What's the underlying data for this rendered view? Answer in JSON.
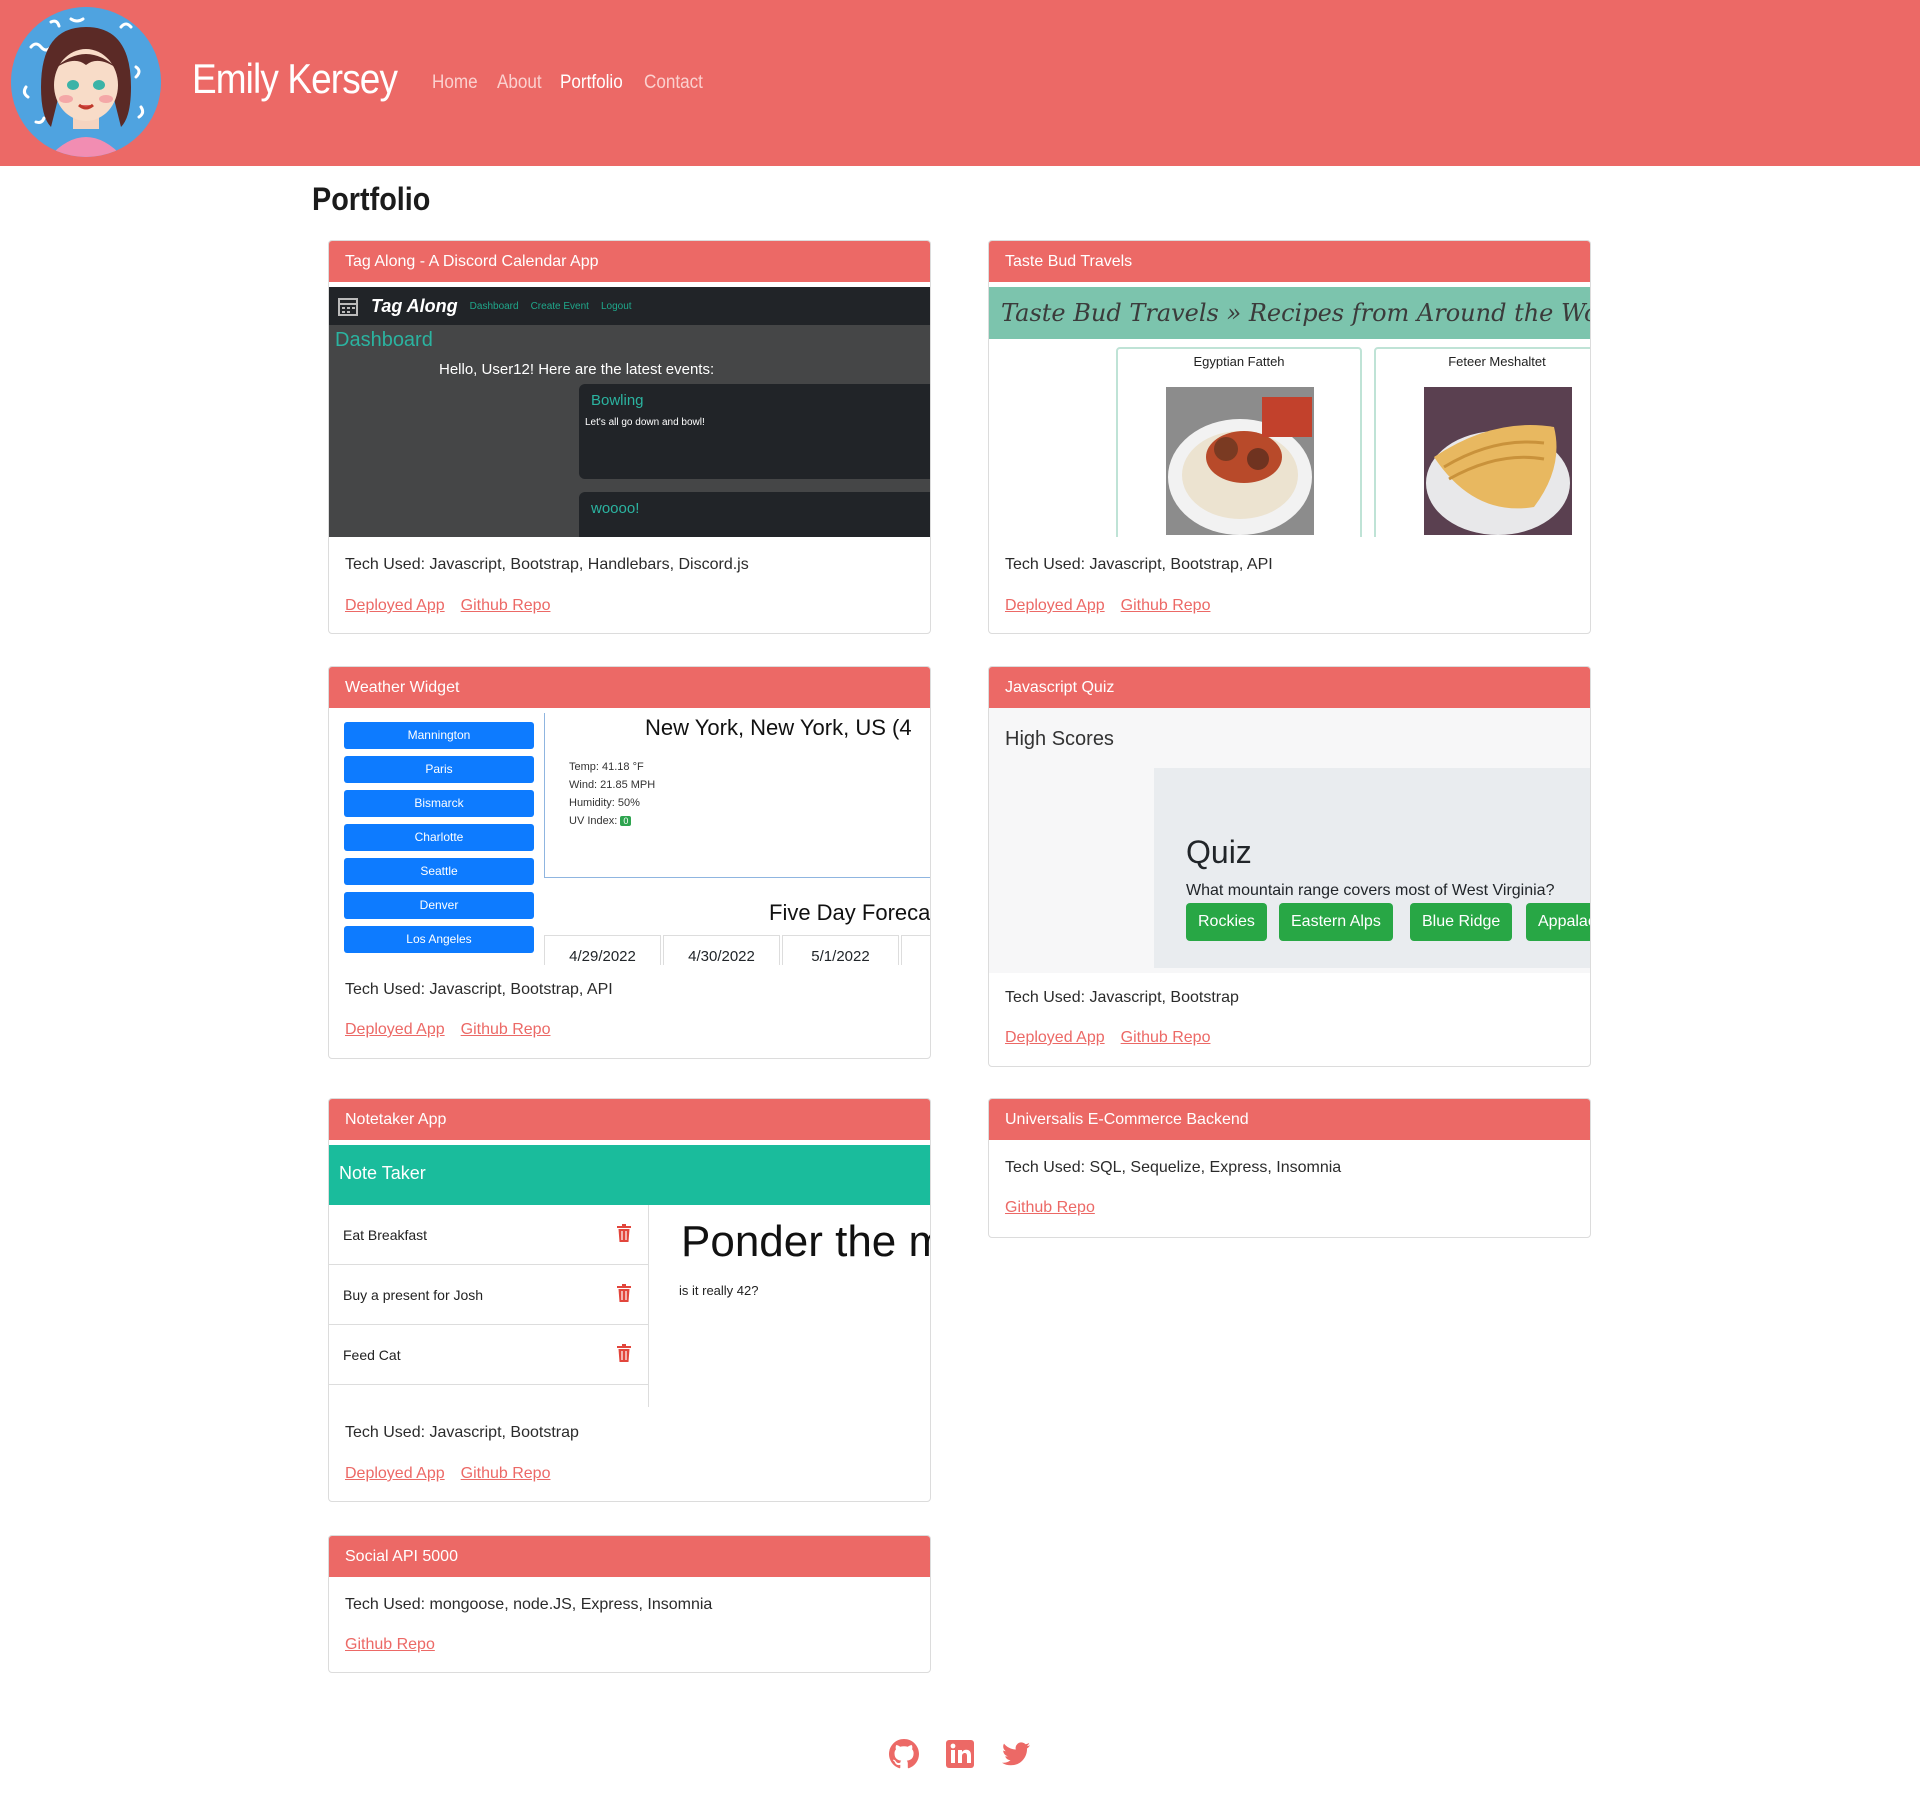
{
  "header": {
    "name": "Emily Kersey",
    "nav": [
      "Home",
      "About",
      "Portfolio",
      "Contact"
    ],
    "active": "Portfolio"
  },
  "page_title": "Portfolio",
  "colors": {
    "brand": "#ec6966",
    "link": "#ec6966"
  },
  "projects": [
    {
      "title": "Tag Along - A Discord Calendar App",
      "tech": "Tech Used: Javascript, Bootstrap, Handlebars, Discord.js",
      "links": [
        "Deployed App",
        "Github Repo"
      ],
      "screenshot": {
        "logo": "Tag Along",
        "nav": [
          "Dashboard",
          "Create Event",
          "Logout"
        ],
        "heading": "Dashboard",
        "greeting": "Hello, User12! Here are the latest events:",
        "events": [
          {
            "title": "Bowling",
            "desc": "Let's all go down and bowl!"
          },
          {
            "title": "woooo!",
            "desc": ""
          }
        ]
      }
    },
    {
      "title": "Taste Bud Travels",
      "tech": "Tech Used: Javascript, Bootstrap, API",
      "links": [
        "Deployed App",
        "Github Repo"
      ],
      "screenshot": {
        "banner": "Taste Bud Travels » Recipes from Around the World",
        "recipes": [
          "Egyptian Fatteh",
          "Feteer Meshaltet"
        ]
      }
    },
    {
      "title": "Weather Widget",
      "tech": "Tech Used: Javascript, Bootstrap, API",
      "links": [
        "Deployed App",
        "Github Repo"
      ],
      "screenshot": {
        "cities": [
          "Mannington",
          "Paris",
          "Bismarck",
          "Charlotte",
          "Seattle",
          "Denver",
          "Los Angeles"
        ],
        "current_city": "New York, New York, US (4",
        "stats": [
          "Temp: 41.18 °F",
          "Wind: 21.85 MPH",
          "Humidity: 50%"
        ],
        "uv_label": "UV Index:",
        "uv_value": "0",
        "forecast_title": "Five Day Foreca",
        "days": [
          "4/29/2022",
          "4/30/2022",
          "5/1/2022"
        ]
      }
    },
    {
      "title": "Javascript Quiz",
      "tech": "Tech Used: Javascript, Bootstrap",
      "links": [
        "Deployed App",
        "Github Repo"
      ],
      "screenshot": {
        "high_scores": "High Scores",
        "quiz_title": "Quiz",
        "question": "What mountain range covers most of West Virginia?",
        "answers": [
          "Rockies",
          "Eastern Alps",
          "Blue Ridge",
          "Appalac"
        ]
      }
    },
    {
      "title": "Notetaker App",
      "tech": "Tech Used: Javascript, Bootstrap",
      "links": [
        "Deployed App",
        "Github Repo"
      ],
      "screenshot": {
        "app_title": "Note Taker",
        "notes": [
          "Eat Breakfast",
          "Buy a present for Josh",
          "Feed Cat"
        ],
        "active_title": "Ponder the m",
        "active_text": "is it really 42?"
      }
    },
    {
      "title": "Universalis E-Commerce Backend",
      "tech": "Tech Used: SQL, Sequelize, Express, Insomnia",
      "links": [
        "Github Repo"
      ]
    },
    {
      "title": "Social API 5000",
      "tech": "Tech Used: mongoose, node.JS, Express, Insomnia",
      "links": [
        "Github Repo"
      ]
    }
  ],
  "footer": {
    "icons": [
      "github-icon",
      "linkedin-icon",
      "twitter-icon"
    ]
  }
}
